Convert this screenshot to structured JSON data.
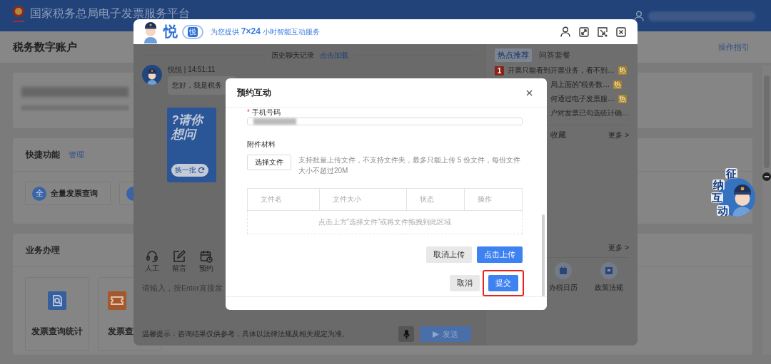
{
  "header": {
    "title": "国家税务总局电子发票服务平台"
  },
  "page": {
    "title": "税务数字账户",
    "guide_link": "操作指引",
    "quick": {
      "title": "快捷功能",
      "manage": "管理",
      "items": [
        {
          "kind": "full",
          "icon": "全",
          "label": "全量发票查询"
        },
        {
          "kind": "cut"
        }
      ]
    },
    "business": {
      "title": "业务办理",
      "tiles": [
        {
          "label": "发票查询统计",
          "kind": "search"
        },
        {
          "label": "发票查",
          "kind": "ticket"
        }
      ]
    }
  },
  "float_badge": {
    "text": "征纳互动"
  },
  "chat": {
    "brand": "悦",
    "badge": "悦",
    "slogan": "为您提供 **7×24** 小时智能互动服务",
    "history": "历史聊天记录",
    "load": "点击加载",
    "message": {
      "sender": "悦悦 | 14:51:11",
      "text": "您好，我是税务"
    },
    "prompt_card": {
      "title": "?请你想问",
      "refresh": "换一批"
    },
    "tools": [
      {
        "label": "人工",
        "kind": "headset"
      },
      {
        "label": "留言",
        "kind": "note"
      },
      {
        "label": "预约",
        "kind": "calendar"
      }
    ],
    "input": {
      "placeholder": "请输入，按Enter直接发"
    },
    "tip": "温馨提示：咨询结果仅供参考，具体以法律法规及相关规定为准。",
    "send": {
      "label": "发送",
      "disabled": true
    },
    "side": {
      "tabs": [
        {
          "label": "热点推荐",
          "selected": true
        },
        {
          "label": "问答套餐",
          "selected": false
        }
      ],
      "hot": [
        {
          "rank": "1",
          "text": "开票只能看到开票业务，看不到…",
          "tag": "热"
        },
        {
          "text": "局上面的“税务数…",
          "tag": "热"
        },
        {
          "text": "何通过电子发票服…",
          "tag": "热"
        },
        {
          "text": "户对发票已勾选统计确…"
        }
      ],
      "favorites": {
        "label": "收藏",
        "more": "更多 >"
      },
      "services": {
        "more": "更多 >",
        "items": [
          {
            "label": "办税日历",
            "kind": "calendar"
          },
          {
            "label": "政策法规",
            "kind": "book"
          }
        ]
      }
    }
  },
  "modal": {
    "title": "预约互动",
    "phone": {
      "required_mark": "*",
      "label": "手机号码"
    },
    "attach_label": "附件材料",
    "choose": "选择文件",
    "hint": "支持批量上传文件，不支持文件夹，最多只能上传 5 份文件，每份文件大小不超过20M",
    "columns": [
      "文件名",
      "文件大小",
      "状态",
      "操作"
    ],
    "empty": "点击上方“选择文件”或将文件拖拽到此区域",
    "upload_buttons": [
      {
        "label": "取消上传",
        "kind": "default"
      },
      {
        "label": "点击上传",
        "kind": "primary"
      }
    ],
    "footer_buttons": [
      {
        "label": "取消",
        "kind": "default",
        "highlighted": false
      },
      {
        "label": "提交",
        "kind": "primary",
        "highlighted": true
      }
    ]
  }
}
